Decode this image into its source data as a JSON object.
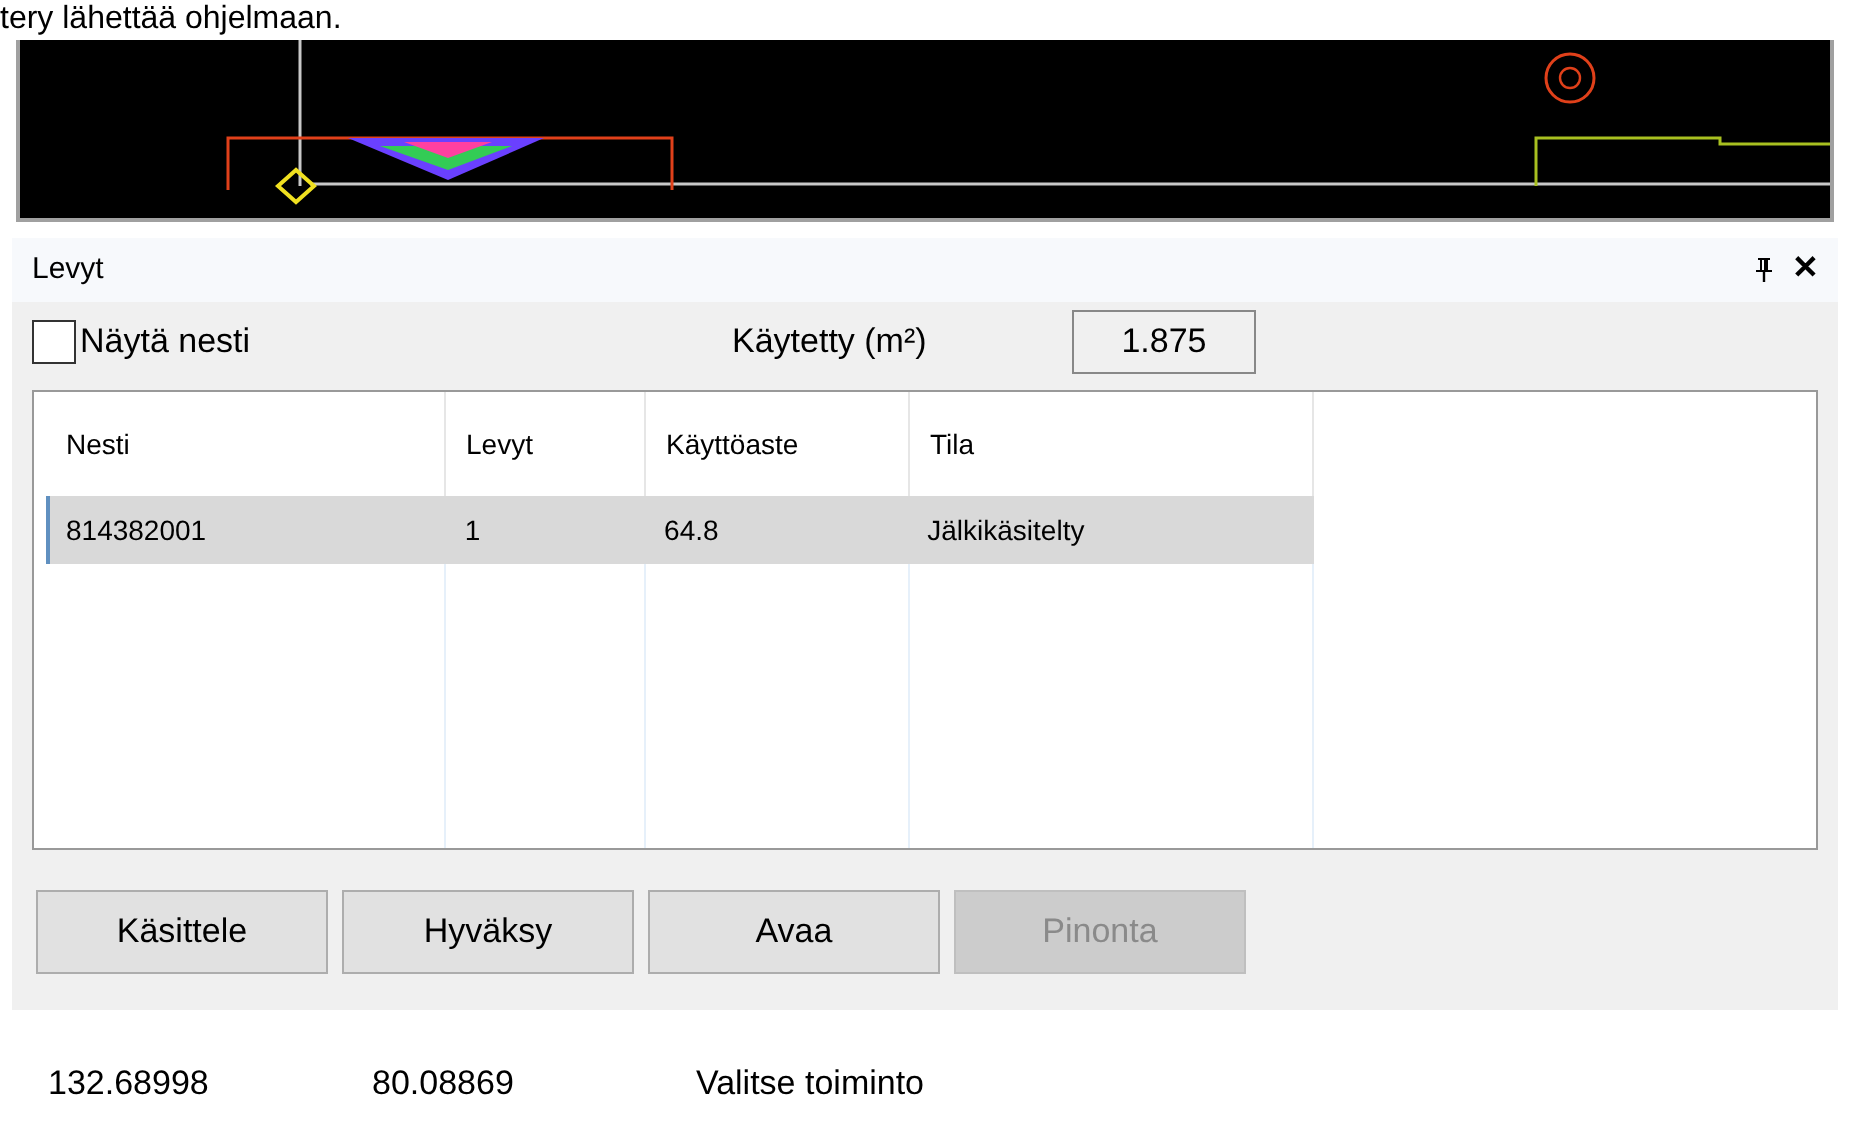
{
  "top_text": "tery lähettää ohjelmaan.",
  "panel": {
    "title": "Levyt",
    "close": "✕"
  },
  "options": {
    "show_nest": {
      "label": "Näytä nesti",
      "checked": false
    },
    "used_label": "Käytetty (m²)",
    "used_value": "1.875"
  },
  "table": {
    "columns": [
      "Nesti",
      "Levyt",
      "Käyttöaste",
      "Tila"
    ],
    "rows": [
      {
        "cells": [
          "814382001",
          "1",
          "64.8",
          "Jälkikäsitelty"
        ],
        "selected": true
      }
    ]
  },
  "buttons": [
    {
      "label": "Käsittele",
      "disabled": false
    },
    {
      "label": "Hyväksy",
      "disabled": false
    },
    {
      "label": "Avaa",
      "disabled": false
    },
    {
      "label": "Pinonta",
      "disabled": true
    }
  ],
  "status_bar": [
    "132.68998",
    "80.08869",
    "Valitse toiminto"
  ]
}
